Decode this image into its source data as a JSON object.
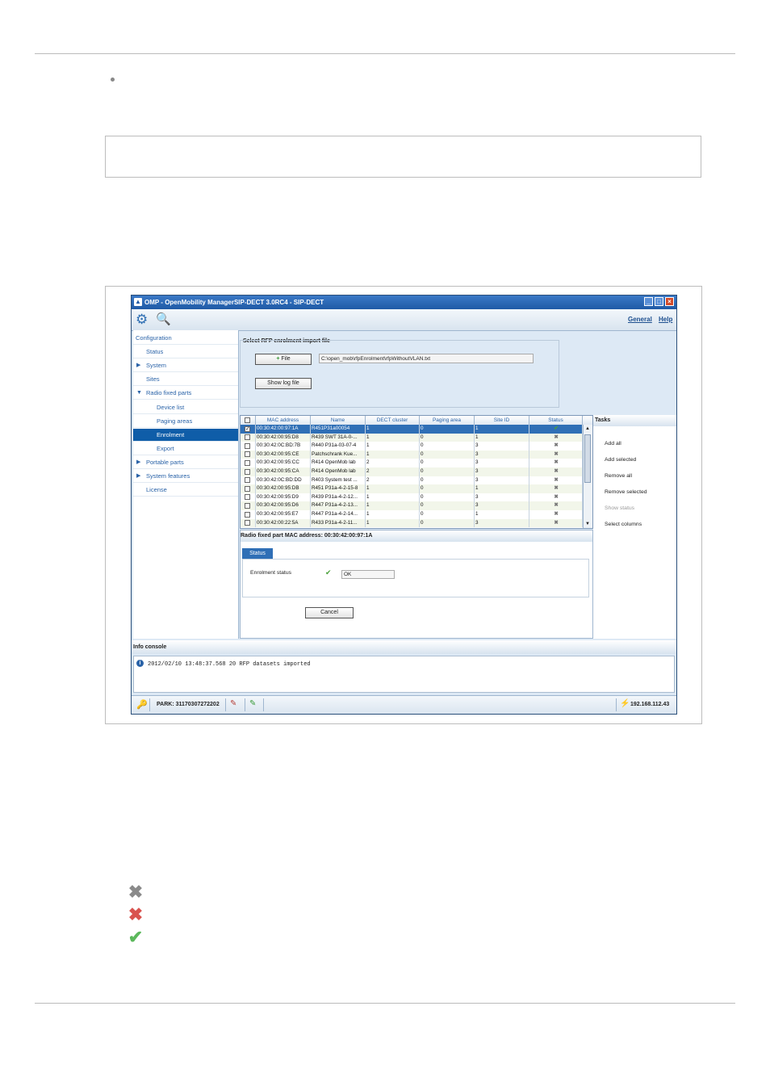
{
  "window": {
    "title": "OMP - OpenMobility ManagerSIP-DECT 3.0RC4 - SIP-DECT",
    "app_icon": "omp-logo-icon",
    "minimize": "_",
    "maximize": "□",
    "close": "×"
  },
  "toolbar": {
    "config_icon": "gear-icon",
    "search_icon": "search-icon",
    "general_link": "General",
    "help_link": "Help"
  },
  "sidebar": {
    "items": [
      {
        "label": "Configuration"
      },
      {
        "label": "Status"
      },
      {
        "label": "System"
      },
      {
        "label": "Sites"
      },
      {
        "label": "Radio fixed parts"
      },
      {
        "label": "Device list"
      },
      {
        "label": "Paging areas"
      },
      {
        "label": "Enrolment"
      },
      {
        "label": "Export"
      },
      {
        "label": "Portable parts"
      },
      {
        "label": "System features"
      },
      {
        "label": "License"
      }
    ]
  },
  "import": {
    "title": "Select RFP enrolment import file",
    "file_button": "File",
    "path": "C:\\open_mob\\rfpEnrolment\\rfpWithoutVLAN.txt",
    "show_log_button": "Show log file"
  },
  "table": {
    "columns": [
      "MAC address",
      "Name",
      "DECT cluster",
      "Paging area",
      "Site ID",
      "Status"
    ],
    "rows": [
      {
        "checked": "✓",
        "mac": "00:30:42:00:97:1A",
        "name": "R451P31a00054",
        "cluster": "1",
        "paging": "0",
        "site": "1",
        "status": "✔"
      },
      {
        "checked": "",
        "mac": "00:30:42:00:95:D8",
        "name": "R439 SWT 31A-0-...",
        "cluster": "1",
        "paging": "0",
        "site": "1",
        "status": "✖"
      },
      {
        "checked": "",
        "mac": "00:30:42:0C:BD:7B",
        "name": "R440 P31a-03-07-4",
        "cluster": "1",
        "paging": "0",
        "site": "3",
        "status": "✖"
      },
      {
        "checked": "",
        "mac": "00:30:42:00:95:CE",
        "name": "Patchschrank Kue...",
        "cluster": "1",
        "paging": "0",
        "site": "3",
        "status": "✖"
      },
      {
        "checked": "",
        "mac": "00:30:42:00:95:CC",
        "name": "R414 OpenMob lab",
        "cluster": "2",
        "paging": "0",
        "site": "3",
        "status": "✖"
      },
      {
        "checked": "",
        "mac": "00:30:42:00:95:CA",
        "name": "R414 OpenMob lab",
        "cluster": "2",
        "paging": "0",
        "site": "3",
        "status": "✖"
      },
      {
        "checked": "",
        "mac": "00:30:42:0C:BD:DD",
        "name": "R403 System test ...",
        "cluster": "2",
        "paging": "0",
        "site": "3",
        "status": "✖"
      },
      {
        "checked": "",
        "mac": "00:30:42:00:95:DB",
        "name": "R451 P31a-4-2-15-8",
        "cluster": "1",
        "paging": "0",
        "site": "1",
        "status": "✖"
      },
      {
        "checked": "",
        "mac": "00:30:42:00:95:D9",
        "name": "R439 P31a-4-2-12...",
        "cluster": "1",
        "paging": "0",
        "site": "3",
        "status": "✖"
      },
      {
        "checked": "",
        "mac": "00:30:42:00:95:D6",
        "name": "R447 P31a-4-2-13...",
        "cluster": "1",
        "paging": "0",
        "site": "3",
        "status": "✖"
      },
      {
        "checked": "",
        "mac": "00:30:42:00:95:E7",
        "name": "R447 P31a-4-2-14...",
        "cluster": "1",
        "paging": "0",
        "site": "1",
        "status": "✖"
      },
      {
        "checked": "",
        "mac": "00:30:42:00:22:5A",
        "name": "R433 P31a-4-2-11...",
        "cluster": "1",
        "paging": "0",
        "site": "3",
        "status": "✖"
      }
    ]
  },
  "tasks": {
    "title": "Tasks",
    "items": [
      {
        "label": "Add all",
        "enabled": true
      },
      {
        "label": "Add selected",
        "enabled": true
      },
      {
        "label": "Remove all",
        "enabled": true
      },
      {
        "label": "Remove selected",
        "enabled": true
      },
      {
        "label": "Show status",
        "enabled": false
      },
      {
        "label": "Select columns",
        "enabled": true
      }
    ]
  },
  "detail": {
    "title": "Radio fixed part MAC address: 00:30:42:00:97:1A",
    "tab": "Status",
    "field_label": "Enrolment status",
    "check_icon": "✔",
    "field_value": "OK",
    "cancel_button": "Cancel"
  },
  "console": {
    "title": "Info console",
    "message": "2012/02/10 13:48:37.568 20 RFP datasets imported"
  },
  "statusbar": {
    "park": "PARK: 31170307272202",
    "ip": "192.168.112.43"
  },
  "legend": {
    "grey_x": "✖",
    "red_x": "✖",
    "green_check": "✔",
    "colors": {
      "grey": "#8a8a8a",
      "red": "#d9534f",
      "green": "#5cb85c"
    }
  }
}
